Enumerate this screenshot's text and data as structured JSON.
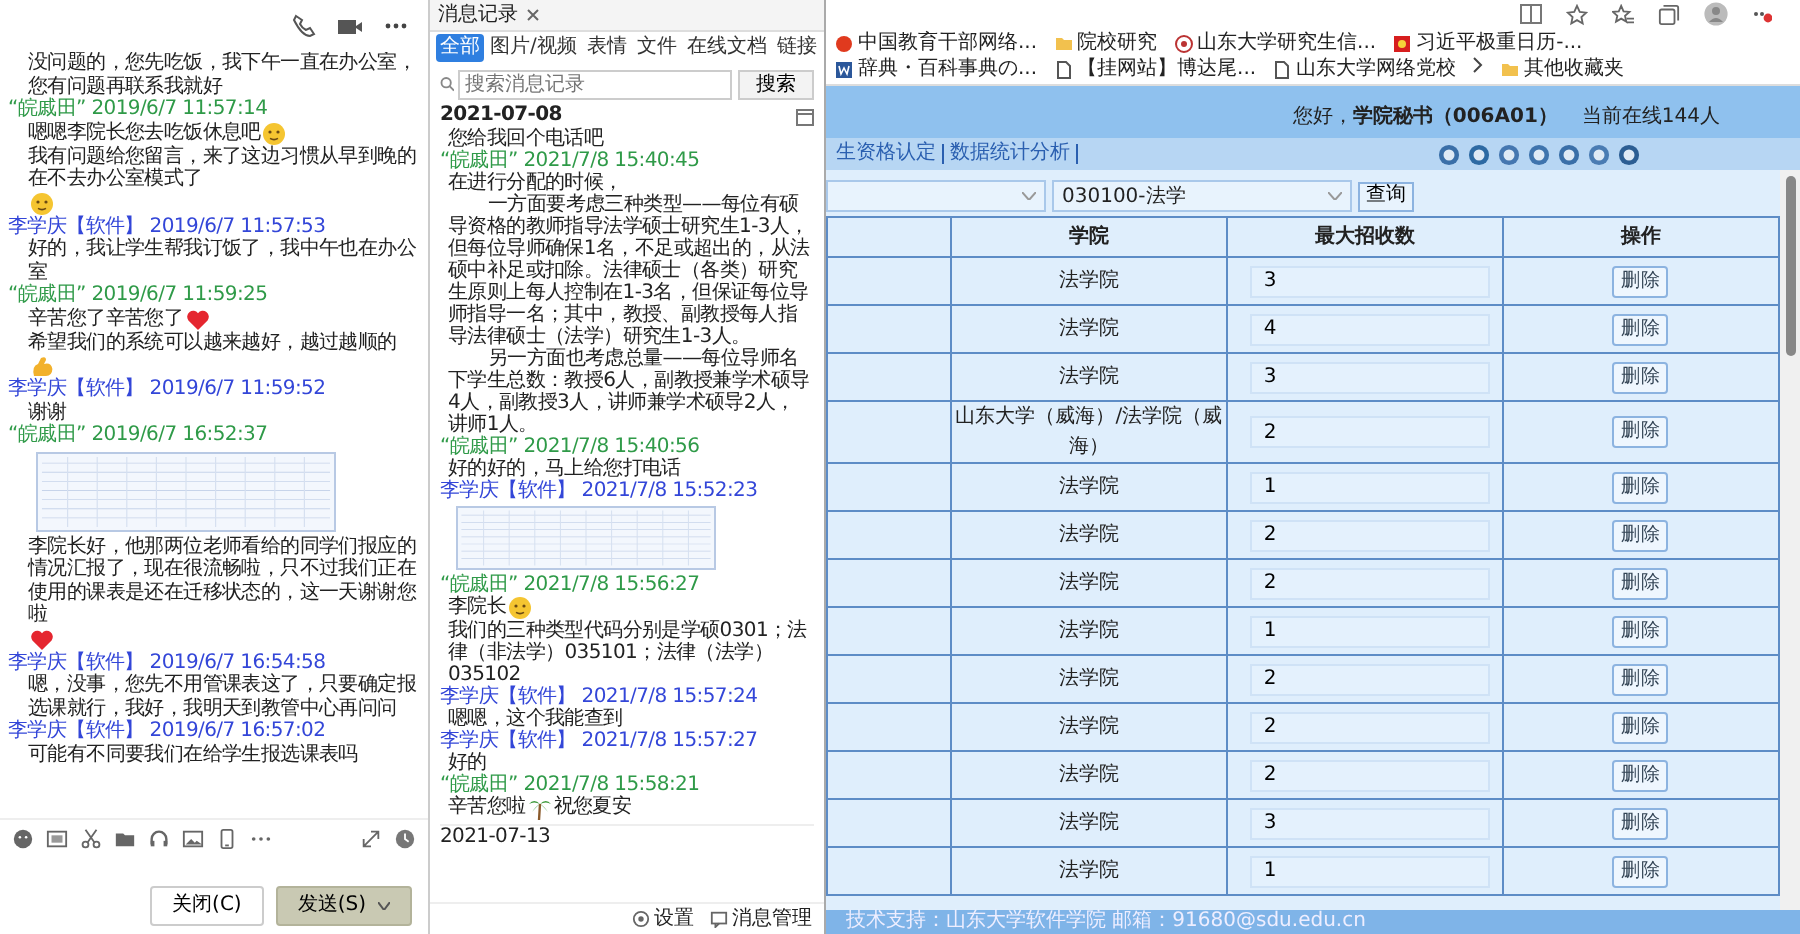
{
  "chat_window": {
    "entries": [
      {
        "kind": "text",
        "parts": [
          {
            "kind": "text",
            "text": "没问题的，您先吃饭，我下午一直在办公室，您有问题再联系我就好"
          }
        ]
      },
      {
        "kind": "meta",
        "sender": "“皖戚田”",
        "time": "2019/6/7 11:57:14",
        "color": "#2f9a48"
      },
      {
        "kind": "text",
        "parts": [
          {
            "kind": "text",
            "text": "嗯嗯李院长您去吃饭休息吧"
          },
          {
            "kind": "face"
          },
          {
            "kind": "text",
            "text": "我有问题给您留言，来了这边习惯从早到晚的在不去办公室模式了"
          },
          {
            "kind": "face"
          }
        ]
      },
      {
        "kind": "meta",
        "sender": "李学庆【软件】",
        "time": "2019/6/7 11:57:53",
        "color": "#3346d8"
      },
      {
        "kind": "text",
        "parts": [
          {
            "kind": "text",
            "text": "好的，我让学生帮我订饭了，我中午也在办公室"
          }
        ]
      },
      {
        "kind": "meta",
        "sender": "“皖戚田”",
        "time": "2019/6/7 11:59:25",
        "color": "#2f9a48"
      },
      {
        "kind": "text",
        "parts": [
          {
            "kind": "text",
            "text": "辛苦您了辛苦您了"
          },
          {
            "kind": "heart"
          },
          {
            "kind": "text",
            "text": "希望我们的系统可以越来越好，越过越顺的"
          },
          {
            "kind": "arm"
          }
        ]
      },
      {
        "kind": "meta",
        "sender": "李学庆【软件】",
        "time": "2019/6/7 11:59:52",
        "color": "#3346d8"
      },
      {
        "kind": "text",
        "parts": [
          {
            "kind": "text",
            "text": "谢谢"
          }
        ]
      },
      {
        "kind": "meta",
        "sender": "“皖戚田”",
        "time": "2019/6/7 16:52:37",
        "color": "#2f9a48"
      },
      {
        "kind": "image"
      },
      {
        "kind": "text",
        "parts": [
          {
            "kind": "text",
            "text": "李院长好，他那两位老师看给的同学们报应的情况汇报了，现在很流畅啦，只不过我们正在使用的课表是还在迁移状态的，这一天谢谢您啦"
          },
          {
            "kind": "heart"
          }
        ]
      },
      {
        "kind": "meta",
        "sender": "李学庆【软件】",
        "time": "2019/6/7 16:54:58",
        "color": "#3346d8"
      },
      {
        "kind": "text",
        "parts": [
          {
            "kind": "text",
            "text": "嗯，没事，您先不用管课表这了，只要确定报选课就行，我好，我明天到教管中心再问问"
          }
        ]
      },
      {
        "kind": "meta",
        "sender": "李学庆【软件】",
        "time": "2019/6/7 16:57:02",
        "color": "#3346d8"
      },
      {
        "kind": "text",
        "parts": [
          {
            "kind": "text",
            "text": "可能有不同要我们在给学生报选课表吗"
          }
        ]
      }
    ],
    "buttons": [
      {
        "label": "关闭(C)",
        "kind": "plain"
      },
      {
        "label": "发送(S)",
        "kind": "primary"
      }
    ]
  },
  "history": {
    "tab": "消息记录",
    "filters": [
      {
        "label": "全部",
        "selected": true
      },
      {
        "label": "图片/视频",
        "selected": false
      },
      {
        "label": "表情",
        "selected": false
      },
      {
        "label": "文件",
        "selected": false
      },
      {
        "label": "在线文档",
        "selected": false
      },
      {
        "label": "链接",
        "selected": false
      }
    ],
    "search": {
      "placeholder": "搜索消息记录",
      "button": "搜索"
    },
    "entries": [
      {
        "kind": "date",
        "text": "2021-07-08"
      },
      {
        "kind": "text",
        "parts": [
          {
            "kind": "text",
            "text": "您给我回个电话吧"
          }
        ]
      },
      {
        "kind": "meta",
        "sender": "“皖戚田”",
        "time": "2021/7/8 15:40:45",
        "color": "#2f9a48"
      },
      {
        "kind": "text",
        "parts": [
          {
            "kind": "text",
            "text": "在进行分配的时候，"
          }
        ]
      },
      {
        "kind": "paragraph",
        "parts": [
          {
            "kind": "text",
            "text": "一方面要考虑三种类型——每位有硕导资格的教师指导法学硕士研究生1-3人，但每位导师确保1名，不足或超出的，从法硕中补足或扣除。法律硕士（各类）研究生原则上每人控制在1-3名，但保证每位导师指导一名；其中，教授、副教授每人指导法律硕士（法学）研究生1-3人。"
          }
        ]
      },
      {
        "kind": "paragraph",
        "parts": [
          {
            "kind": "text",
            "text": "另一方面也考虑总量——每位导师名下学生总数：教授6人，副教授兼学术硕导4人，副教授3人，讲师兼学术硕导2人，讲师1人。"
          }
        ]
      },
      {
        "kind": "meta",
        "sender": "“皖戚田”",
        "time": "2021/7/8 15:40:56",
        "color": "#2f9a48"
      },
      {
        "kind": "text",
        "parts": [
          {
            "kind": "text",
            "text": "好的好的，马上给您打电话"
          }
        ]
      },
      {
        "kind": "meta",
        "sender": "李学庆【软件】",
        "time": "2021/7/8 15:52:23",
        "color": "#3346d8"
      },
      {
        "kind": "image"
      },
      {
        "kind": "meta",
        "sender": "“皖戚田”",
        "time": "2021/7/8 15:56:27",
        "color": "#2f9a48"
      },
      {
        "kind": "text",
        "parts": [
          {
            "kind": "text",
            "text": "李院长"
          },
          {
            "kind": "face"
          },
          {
            "kind": "text",
            "text": "我们的三种类型代码分别是学硕0301；法律（非法学）035101；法律（法学）035102"
          }
        ]
      },
      {
        "kind": "meta",
        "sender": "李学庆【软件】",
        "time": "2021/7/8 15:57:24",
        "color": "#3346d8"
      },
      {
        "kind": "text",
        "parts": [
          {
            "kind": "text",
            "text": "嗯嗯，这个我能查到"
          }
        ]
      },
      {
        "kind": "meta",
        "sender": "李学庆【软件】",
        "time": "2021/7/8 15:57:27",
        "color": "#3346d8"
      },
      {
        "kind": "text",
        "parts": [
          {
            "kind": "text",
            "text": "好的"
          }
        ]
      },
      {
        "kind": "meta",
        "sender": "“皖戚田”",
        "time": "2021/7/8 15:58:21",
        "color": "#2f9a48"
      },
      {
        "kind": "text",
        "parts": [
          {
            "kind": "text",
            "text": "辛苦您啦"
          },
          {
            "kind": "palm"
          },
          {
            "kind": "text",
            "text": "祝您夏安"
          }
        ]
      },
      {
        "kind": "date",
        "text": "2021-07-13"
      }
    ],
    "footer": [
      "设置",
      "消息管理"
    ]
  },
  "browser": {
    "bookmarks": [
      {
        "label": "中国教育干部网络...",
        "kind": "logo"
      },
      {
        "label": "院校研究",
        "kind": "folder"
      },
      {
        "label": "山东大学研究生信...",
        "kind": "seal"
      },
      {
        "label": "习近平极重日历-...",
        "kind": "flag"
      },
      {
        "label": "辞典・百科事典の...",
        "kind": "doc"
      },
      {
        "label": "【挂网站】博达尾...",
        "kind": "page"
      },
      {
        "label": "山东大学网络党校",
        "kind": "page"
      },
      {
        "label": "其他收藏夹",
        "kind": "folder"
      }
    ],
    "header": {
      "greeting": "您好，**学院秘书（006A01）**",
      "online": "当前在线144人"
    },
    "nav": [
      "生资格认定",
      "数据统计分析"
    ],
    "filter": {
      "program": "030100-法学",
      "button": "查询"
    },
    "table": {
      "columns": [
        "学院",
        "最大招收数",
        "操作"
      ],
      "rows": [
        {
          "college": "法学院",
          "max": "3",
          "action": "删除"
        },
        {
          "college": "法学院",
          "max": "4",
          "action": "删除"
        },
        {
          "college": "法学院",
          "max": "3",
          "action": "删除"
        },
        {
          "college": "山东大学（威海）/法学院（威海）",
          "max": "2",
          "action": "删除"
        },
        {
          "college": "法学院",
          "max": "1",
          "action": "删除"
        },
        {
          "college": "法学院",
          "max": "2",
          "action": "删除"
        },
        {
          "college": "法学院",
          "max": "2",
          "action": "删除"
        },
        {
          "college": "法学院",
          "max": "1",
          "action": "删除"
        },
        {
          "college": "法学院",
          "max": "2",
          "action": "删除"
        },
        {
          "college": "法学院",
          "max": "2",
          "action": "删除"
        },
        {
          "college": "法学院",
          "max": "2",
          "action": "删除"
        },
        {
          "college": "法学院",
          "max": "3",
          "action": "删除"
        },
        {
          "college": "法学院",
          "max": "1",
          "action": "删除"
        }
      ]
    },
    "footer": "技术支持：山东大学软件学院 邮箱：91680@sdu.edu.cn"
  }
}
